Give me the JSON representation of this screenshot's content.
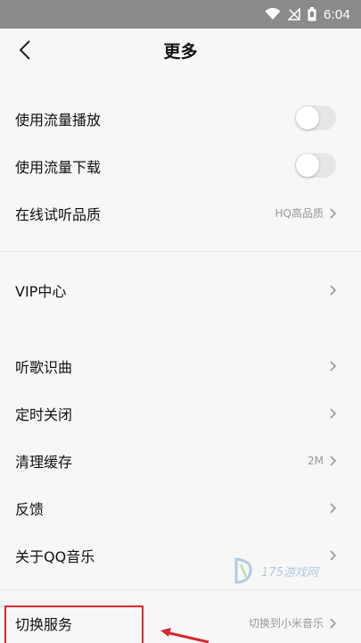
{
  "status_bar": {
    "time": "6:04",
    "icons": [
      "wifi-icon",
      "signal-icon",
      "battery-icon"
    ]
  },
  "header": {
    "title": "更多",
    "back_icon": "chevron-left-icon"
  },
  "group1": [
    {
      "label": "使用流量播放",
      "type": "toggle",
      "on": false
    },
    {
      "label": "使用流量下载",
      "type": "toggle",
      "on": false
    },
    {
      "label": "在线试听品质",
      "type": "nav",
      "value": "HQ高品质"
    }
  ],
  "group2": [
    {
      "label": "VIP中心",
      "type": "nav",
      "value": ""
    }
  ],
  "group3": [
    {
      "label": "听歌识曲",
      "type": "nav",
      "value": ""
    },
    {
      "label": "定时关闭",
      "type": "nav",
      "value": ""
    },
    {
      "label": "清理缓存",
      "type": "nav",
      "value": "2M"
    },
    {
      "label": "反馈",
      "type": "nav",
      "value": ""
    },
    {
      "label": "关于QQ音乐",
      "type": "nav",
      "value": ""
    }
  ],
  "group4": [
    {
      "label": "切换服务",
      "type": "nav",
      "value": "切换到小米音乐"
    }
  ],
  "watermark": {
    "text": "175游戏网"
  },
  "colors": {
    "highlight": "#d6292f",
    "status_bar": "#8b8b8b"
  }
}
